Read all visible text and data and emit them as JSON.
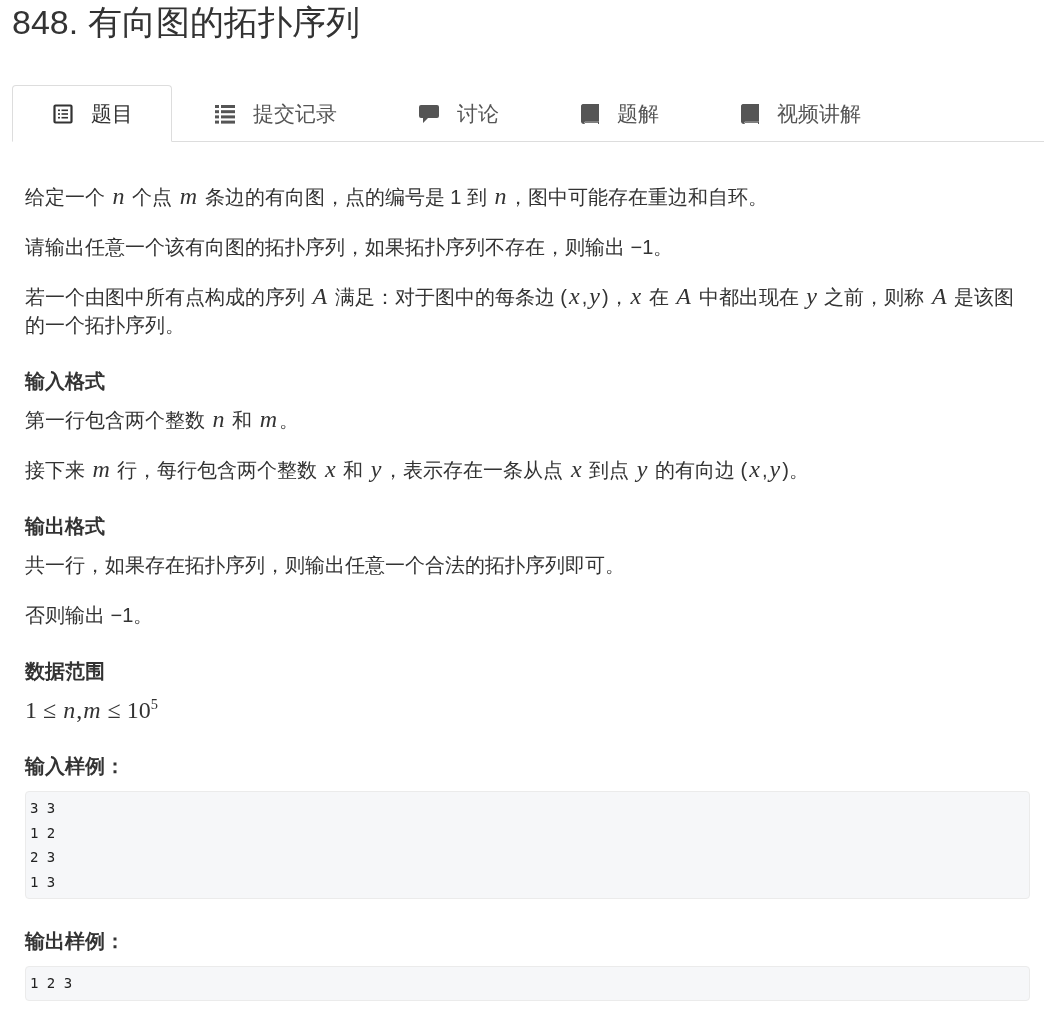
{
  "title": "848. 有向图的拓扑序列",
  "tabs": [
    {
      "label": "题目",
      "selected": true
    },
    {
      "label": "提交记录",
      "selected": false
    },
    {
      "label": "讨论",
      "selected": false
    },
    {
      "label": "题解",
      "selected": false
    },
    {
      "label": "视频讲解",
      "selected": false
    }
  ],
  "content": [
    {
      "kind": "paragraph",
      "text": "给定一个 *n* 个点 *m* 条边的有向图，点的编号是 1 到 *n*，图中可能存在重边和自环。"
    },
    {
      "kind": "paragraph",
      "text": "请输出任意一个该有向图的拓扑序列，如果拓扑序列不存在，则输出 −1。"
    },
    {
      "kind": "paragraph",
      "text": "若一个由图中所有点构成的序列 *A* 满足：对于图中的每条边 (*x*,*y*)，*x* 在 *A* 中都出现在 *y* 之前，则称 *A* 是该图的一个拓扑序列。"
    },
    {
      "kind": "heading",
      "text": "输入格式"
    },
    {
      "kind": "paragraph",
      "text": "第一行包含两个整数 *n* 和 *m*。"
    },
    {
      "kind": "paragraph",
      "text": "接下来 *m* 行，每行包含两个整数 *x* 和 *y*，表示存在一条从点 *x* 到点 *y* 的有向边 (*x*,*y*)。"
    },
    {
      "kind": "heading",
      "text": "输出格式"
    },
    {
      "kind": "paragraph",
      "text": "共一行，如果存在拓扑序列，则输出任意一个合法的拓扑序列即可。"
    },
    {
      "kind": "paragraph",
      "text": "否则输出 −1。"
    },
    {
      "kind": "heading",
      "text": "数据范围"
    },
    {
      "kind": "formula",
      "text": "1 ≤ *n*,*m* ≤ 10$^{5}$"
    },
    {
      "kind": "heading",
      "text": "输入样例："
    },
    {
      "kind": "code",
      "lines": [
        "3 3",
        "1 2",
        "2 3",
        "1 3"
      ]
    },
    {
      "kind": "heading",
      "text": "输出样例："
    },
    {
      "kind": "code",
      "lines": [
        "1 2 3"
      ]
    }
  ]
}
